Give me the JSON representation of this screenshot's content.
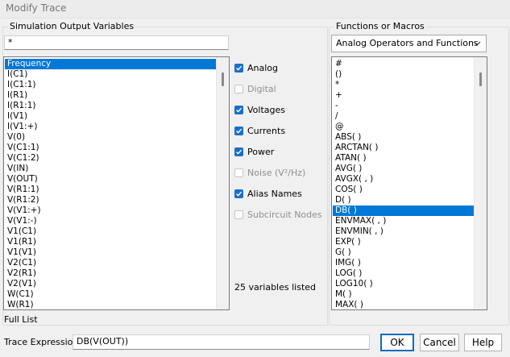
{
  "window": {
    "title": "Modify Trace"
  },
  "sim_vars": {
    "group_title": "Simulation Output Variables",
    "filter_value": "*",
    "items": [
      "Frequency",
      "I(C1)",
      "I(C1:1)",
      "I(R1)",
      "I(R1:1)",
      "I(V1)",
      "I(V1:+)",
      "V(0)",
      "V(C1:1)",
      "V(C1:2)",
      "V(IN)",
      "V(OUT)",
      "V(R1:1)",
      "V(R1:2)",
      "V(V1:+)",
      "V(V1:-)",
      "V1(C1)",
      "V1(R1)",
      "V1(V1)",
      "V2(C1)",
      "V2(R1)",
      "V2(V1)",
      "W(C1)",
      "W(R1)"
    ],
    "selected_index": 0,
    "footer": "Full List"
  },
  "options": {
    "checkboxes": [
      {
        "label": "Analog",
        "checked": true,
        "enabled": true
      },
      {
        "label": "Digital",
        "checked": false,
        "enabled": false
      },
      {
        "label": "Voltages",
        "checked": true,
        "enabled": true
      },
      {
        "label": "Currents",
        "checked": true,
        "enabled": true
      },
      {
        "label": "Power",
        "checked": true,
        "enabled": true
      },
      {
        "label": "Noise (V²/Hz)",
        "checked": false,
        "enabled": false
      },
      {
        "label": "Alias Names",
        "checked": true,
        "enabled": true
      },
      {
        "label": "Subcircuit Nodes",
        "checked": false,
        "enabled": false
      }
    ],
    "count_text": "25 variables listed"
  },
  "functions": {
    "group_title": "Functions or Macros",
    "dropdown_value": "Analog Operators and Functions",
    "items": [
      "#",
      "()",
      "*",
      "+",
      "-",
      "/",
      "@",
      "ABS( )",
      "ARCTAN( )",
      "ATAN( )",
      "AVG( )",
      "AVGX( , )",
      "COS( )",
      "D( )",
      "DB( )",
      "ENVMAX( , )",
      "ENVMIN( , )",
      "EXP( )",
      "G( )",
      "IMG( )",
      "LOG( )",
      "LOG10( )",
      "M( )",
      "MAX( )"
    ],
    "selected_index": 14
  },
  "footer": {
    "expression_label": "Trace Expression:",
    "expression_value": "DB(V(OUT))",
    "ok_label": "OK",
    "cancel_label": "Cancel",
    "help_label": "Help"
  },
  "colors": {
    "accent": "#0078d7",
    "checkbox_on": "#1a6fc9",
    "disabled_text": "#8f8f8f"
  },
  "icons": {
    "dropdown": "chevron-down-icon",
    "checkmark": "checkmark-icon"
  }
}
